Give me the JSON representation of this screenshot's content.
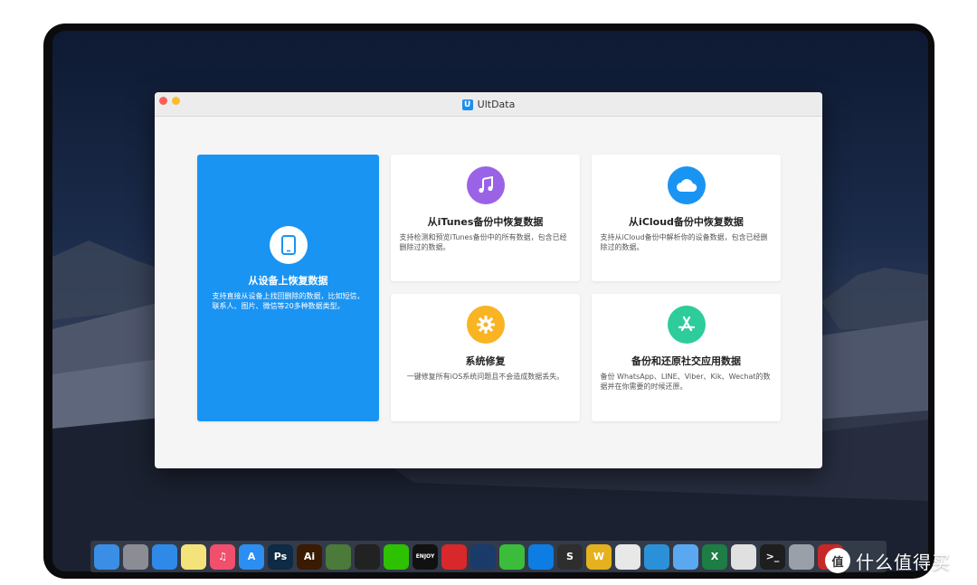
{
  "window": {
    "title": "UltData",
    "logo_letter": "U"
  },
  "cards": [
    {
      "id": "device",
      "title": "从设备上恢复数据",
      "desc": "支持直接从设备上找回删除的数据，比如短信，联系人、图片、微信等20多种数据类型。",
      "icon": "phone-icon",
      "color": "#ffffff"
    },
    {
      "id": "itunes",
      "title": "从iTunes备份中恢复数据",
      "desc": "支持检测和预览iTunes备份中的所有数据，包含已经删除过的数据。",
      "icon": "music-note-icon",
      "color": "#9a63e6"
    },
    {
      "id": "icloud",
      "title": "从iCloud备份中恢复数据",
      "desc": "支持从iCloud备份中解析你的设备数据，包含已经删除过的数据。",
      "icon": "cloud-icon",
      "color": "#1a94f3"
    },
    {
      "id": "repair",
      "title": "系统修复",
      "desc": "一键修复所有iOS系统问题且不会造成数据丢失。",
      "icon": "gear-icon",
      "color": "#f9b323"
    },
    {
      "id": "social",
      "title": "备份和还原社交应用数据",
      "desc": "备份 WhatsApp、LINE、Viber、Kik、Wechat的数据并在你需要的时候还原。",
      "icon": "app-store-icon",
      "color": "#2ecc9b"
    }
  ],
  "dock": [
    {
      "name": "finder-icon",
      "label": "",
      "color": "#3a8ee6"
    },
    {
      "name": "launchpad-icon",
      "label": "",
      "color": "#8c8c94"
    },
    {
      "name": "safari-icon",
      "label": "",
      "color": "#2f89e8"
    },
    {
      "name": "notes-icon",
      "label": "",
      "color": "#f4e37a"
    },
    {
      "name": "itunes-icon",
      "label": "♫",
      "color": "#f04f6e"
    },
    {
      "name": "app-store-icon",
      "label": "A",
      "color": "#2b8ef0"
    },
    {
      "name": "photoshop-icon",
      "label": "Ps",
      "color": "#0e2a44"
    },
    {
      "name": "illustrator-icon",
      "label": "Ai",
      "color": "#3a1a00"
    },
    {
      "name": "image-capture-icon",
      "label": "",
      "color": "#4b7a3a"
    },
    {
      "name": "qq-icon",
      "label": "",
      "color": "#222222"
    },
    {
      "name": "wechat-icon",
      "label": "",
      "color": "#2dc100"
    },
    {
      "name": "enjoy-icon",
      "label": "ENJOY",
      "color": "#111111"
    },
    {
      "name": "netease-music-icon",
      "label": "",
      "color": "#d8282c"
    },
    {
      "name": "video-player-icon",
      "label": "",
      "color": "#1a3a6a"
    },
    {
      "name": "qq-music-icon",
      "label": "",
      "color": "#3bbd3b"
    },
    {
      "name": "teamviewer-icon",
      "label": "",
      "color": "#0e7de3"
    },
    {
      "name": "sublime-icon",
      "label": "S",
      "color": "#2e2e2e"
    },
    {
      "name": "wunderlist-icon",
      "label": "W",
      "color": "#e5b11e"
    },
    {
      "name": "chrome-icon",
      "label": "",
      "color": "#e8e8e8"
    },
    {
      "name": "migration-icon",
      "label": "",
      "color": "#2a91d8"
    },
    {
      "name": "icloud-drive-icon",
      "label": "",
      "color": "#5aa9f0"
    },
    {
      "name": "excel-icon",
      "label": "X",
      "color": "#1d7d45"
    },
    {
      "name": "preview-icon",
      "label": "",
      "color": "#e0e0e0"
    },
    {
      "name": "terminal-icon",
      "label": ">_",
      "color": "#1e1e1e"
    },
    {
      "name": "archive-icon",
      "label": "",
      "color": "#9aa0a8"
    },
    {
      "name": "flashcard-icon",
      "label": "",
      "color": "#c62828"
    }
  ],
  "watermark": {
    "circle": "值",
    "text": "什么值得买"
  }
}
